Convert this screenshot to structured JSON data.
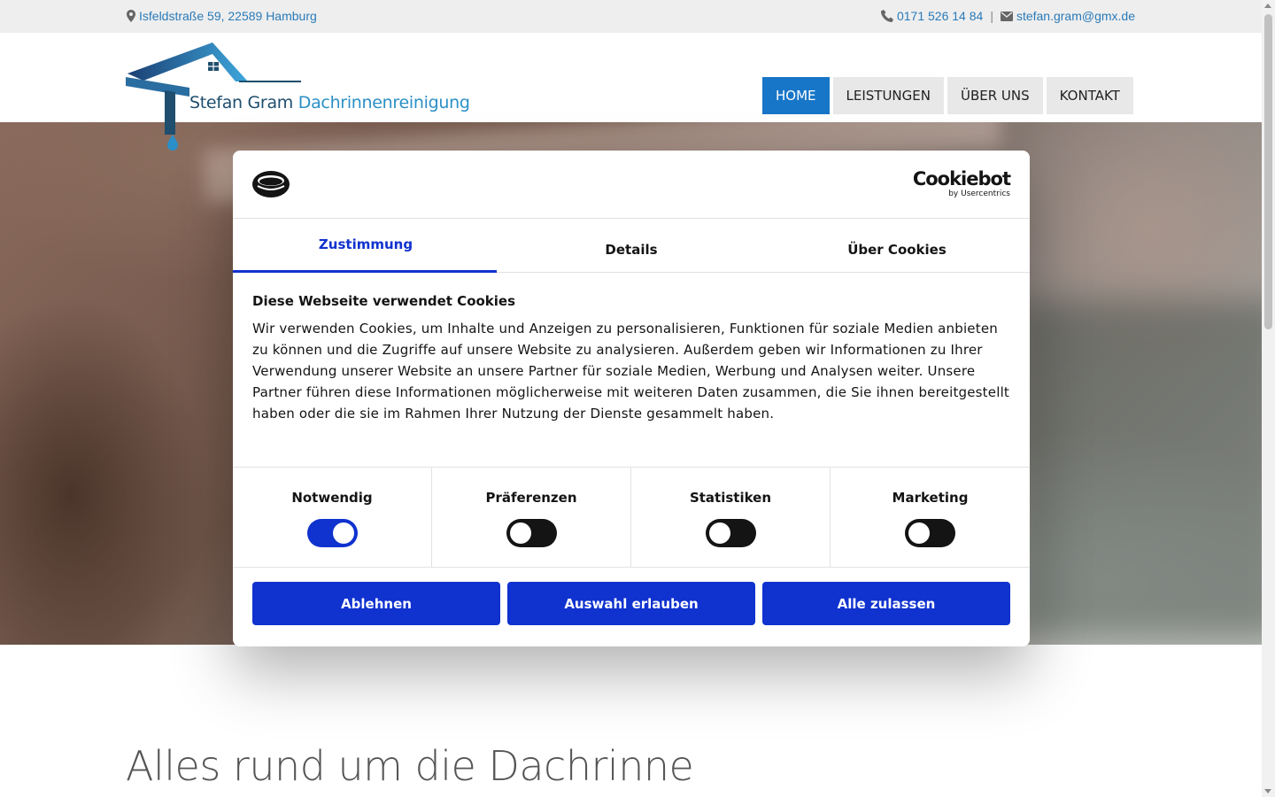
{
  "topbar": {
    "address": "Isfeldstraße 59, 22589 Hamburg",
    "phone": "0171 526 14 84",
    "separator": "|",
    "email": "stefan.gram@gmx.de"
  },
  "logo": {
    "name_part1": "Stefan Gram",
    "name_part2": "Dachrinnenreinigung"
  },
  "nav": {
    "items": [
      {
        "label": "HOME",
        "active": true
      },
      {
        "label": "LEISTUNGEN",
        "active": false
      },
      {
        "label": "ÜBER UNS",
        "active": false
      },
      {
        "label": "KONTAKT",
        "active": false
      }
    ]
  },
  "cookie": {
    "brand": "Cookiebot",
    "brand_by": "by Usercentrics",
    "tabs": [
      "Zustimmung",
      "Details",
      "Über Cookies"
    ],
    "title": "Diese Webseite verwendet Cookies",
    "text": "Wir verwenden Cookies, um Inhalte und Anzeigen zu personalisieren, Funktionen für soziale Medien anbieten zu können und die Zugriffe auf unsere Website zu analysieren. Außerdem geben wir Informationen zu Ihrer Verwendung unserer Website an unsere Partner für soziale Medien, Werbung und Analysen weiter. Unsere Partner führen diese Informationen möglicherweise mit weiteren Daten zusammen, die Sie ihnen bereitgestellt haben oder die sie im Rahmen Ihrer Nutzung der Dienste gesammelt haben.",
    "toggles": [
      {
        "label": "Notwendig",
        "on": true
      },
      {
        "label": "Präferenzen",
        "on": false
      },
      {
        "label": "Statistiken",
        "on": false
      },
      {
        "label": "Marketing",
        "on": false
      }
    ],
    "buttons": [
      "Ablehnen",
      "Auswahl erlauben",
      "Alle zulassen"
    ]
  },
  "headline": "Alles rund um die Dachrinne",
  "colors": {
    "accent": "#1776c8",
    "cookie_blue": "#1032cf",
    "link": "#2a7ab8"
  }
}
